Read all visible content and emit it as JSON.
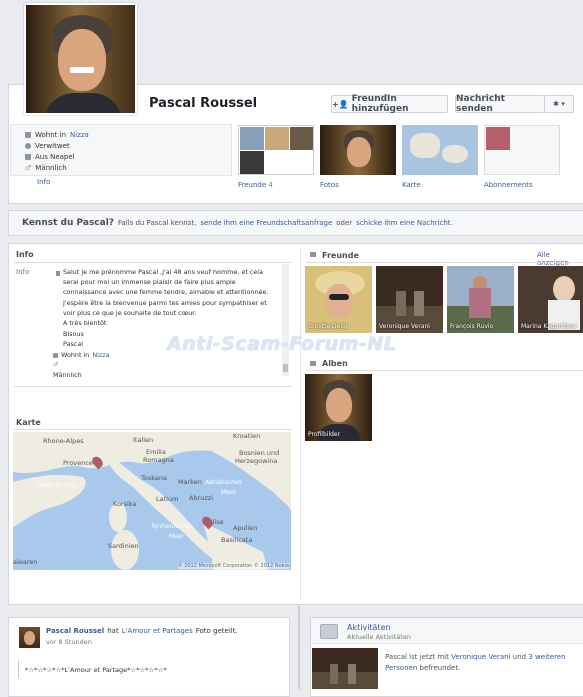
{
  "profile": {
    "name": "Pascal Roussel",
    "add_friend_label": "FreundIn hinzufügen",
    "message_label": "Nachricht senden",
    "settings_label": "✱ ▾"
  },
  "about": {
    "items": [
      "Wohnt in",
      "Verwitwet",
      "Aus Neapel",
      "Männlich"
    ],
    "place_1": "Nizza",
    "info_link": "Info"
  },
  "tiles": [
    {
      "label": "Freunde",
      "count": "4"
    },
    {
      "label": "Fotos"
    },
    {
      "label": "Karte"
    },
    {
      "label": "Abonnements"
    }
  ],
  "know": {
    "title": "Kennst du Pascal?",
    "text_1": "Falls du Pascal kennst,",
    "link_1": "sende ihm eine Freundschaftsanfrage",
    "text_2": "oder",
    "link_2": "schicke ihm eine Nachricht."
  },
  "info": {
    "heading": "Info",
    "label": "Info",
    "body": "Salut je me prénomme Pascal ,j'ai 48 ans veuf homme, et cela serai pour moi un immense plaisir de faire plus ample connaissance avec une femme tendre, aimable et attentionnée. J'espère être la bienvenue parmi tes amies pour sympathiser et voir plus ce que je souhaite de tout cœur.",
    "line_1": "A très bientôt",
    "line_2": "Bisous",
    "line_3": "Pascal",
    "lives_in": "Wohnt in",
    "lives_place": "Nizza",
    "gender": "Männlich"
  },
  "map": {
    "heading": "Karte",
    "labels": [
      "Rhone-Alpes",
      "Italien",
      "Kroatien",
      "Bosnien und",
      "Herzegowina",
      "Emilia",
      "Romagna",
      "Toskana",
      "Marken",
      "Provence",
      "Golfe du Lion",
      "Adriatisches",
      "Meer",
      "Korsika",
      "Latium",
      "Abruzzi",
      "Molise",
      "Apulien",
      "Sardinien",
      "Tyrrhenisches",
      "Meer",
      "Basilicata",
      "alearen"
    ],
    "attribution": "© 2012 Microsoft Corporation  © 2012 Nokia"
  },
  "friends": {
    "heading": "Freunde",
    "see_all": "Alle anzeigen",
    "items": [
      "Brigitte Delor",
      "Veronique Verani",
      "François Ruvio",
      "Marina Kaganitsov"
    ]
  },
  "albums": {
    "heading": "Alben",
    "items": [
      "Profilbilder"
    ]
  },
  "watermark": "Anti-Scam-Forum-NL",
  "post": {
    "author": "Pascal Roussel",
    "action": "hat",
    "page": "L'Amour et Partages",
    "action_2": "Foto geteilt.",
    "time": "vor 8 Stunden",
    "content": "*☆*☆*☆*☆*L'Amour et Partage*☆*☆*☆*☆*"
  },
  "activity": {
    "title": "Aktivitäten",
    "subtitle": "Aktuelle Aktivitäten",
    "text_1": "Pascal ist jetzt mit",
    "link_1": "Veronique Verani",
    "text_2": "und",
    "link_2": "3 weiteren Personen",
    "text_3": "befreundet."
  }
}
